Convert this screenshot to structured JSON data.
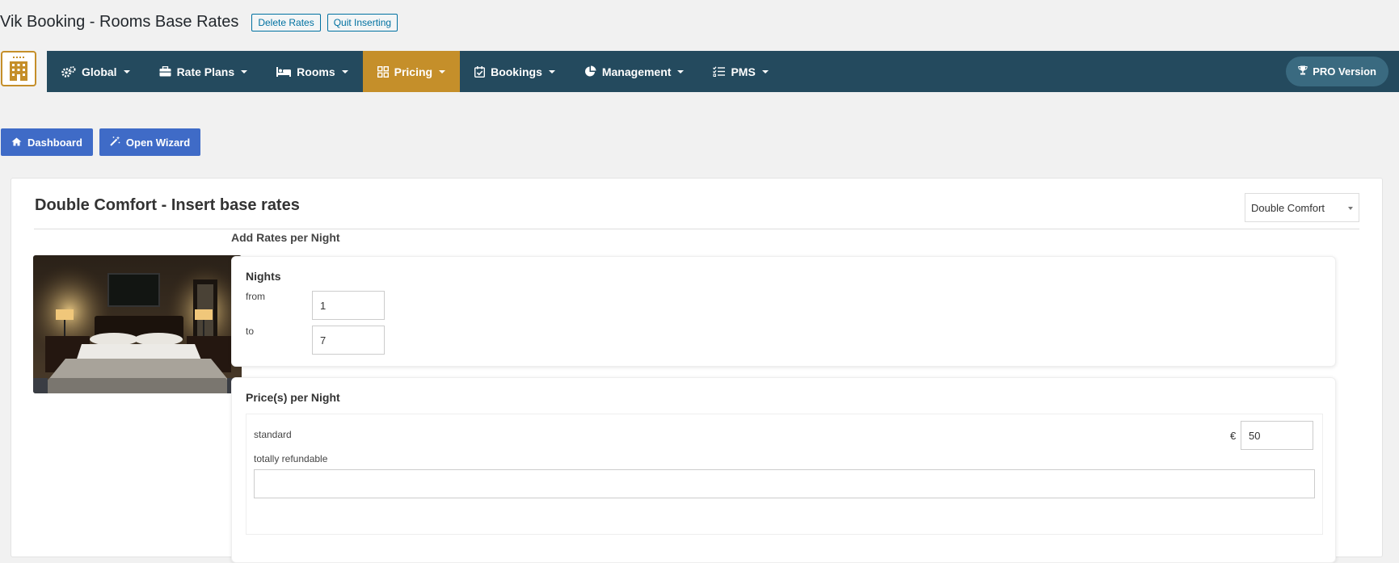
{
  "header": {
    "title": "Vik Booking - Rooms Base Rates",
    "delete_rates": "Delete Rates",
    "quit_inserting": "Quit Inserting"
  },
  "nav": {
    "items": [
      {
        "label": "Global",
        "icon": "gears-icon"
      },
      {
        "label": "Rate Plans",
        "icon": "briefcase-icon"
      },
      {
        "label": "Rooms",
        "icon": "bed-icon"
      },
      {
        "label": "Pricing",
        "icon": "pricing-grid-icon",
        "active": true
      },
      {
        "label": "Bookings",
        "icon": "calendar-check-icon"
      },
      {
        "label": "Management",
        "icon": "pie-chart-icon"
      },
      {
        "label": "PMS",
        "icon": "tasks-list-icon"
      }
    ],
    "pro_label": "PRO Version"
  },
  "actions": {
    "dashboard": "Dashboard",
    "open_wizard": "Open Wizard"
  },
  "card": {
    "title": "Double Comfort - Insert base rates",
    "room_select_value": "Double Comfort",
    "add_rates_label": "Add Rates per Night",
    "nights": {
      "title": "Nights",
      "from_label": "from",
      "from_value": "1",
      "to_label": "to",
      "to_value": "7"
    },
    "prices": {
      "title": "Price(s) per Night",
      "rate_name": "standard",
      "rate_note": "totally refundable",
      "currency": "€",
      "value": "50"
    }
  },
  "colors": {
    "navbar": "#244a5e",
    "active_nav": "#c58f2a",
    "action_button": "#3f6bc7",
    "page_background": "#f1f1f1"
  }
}
